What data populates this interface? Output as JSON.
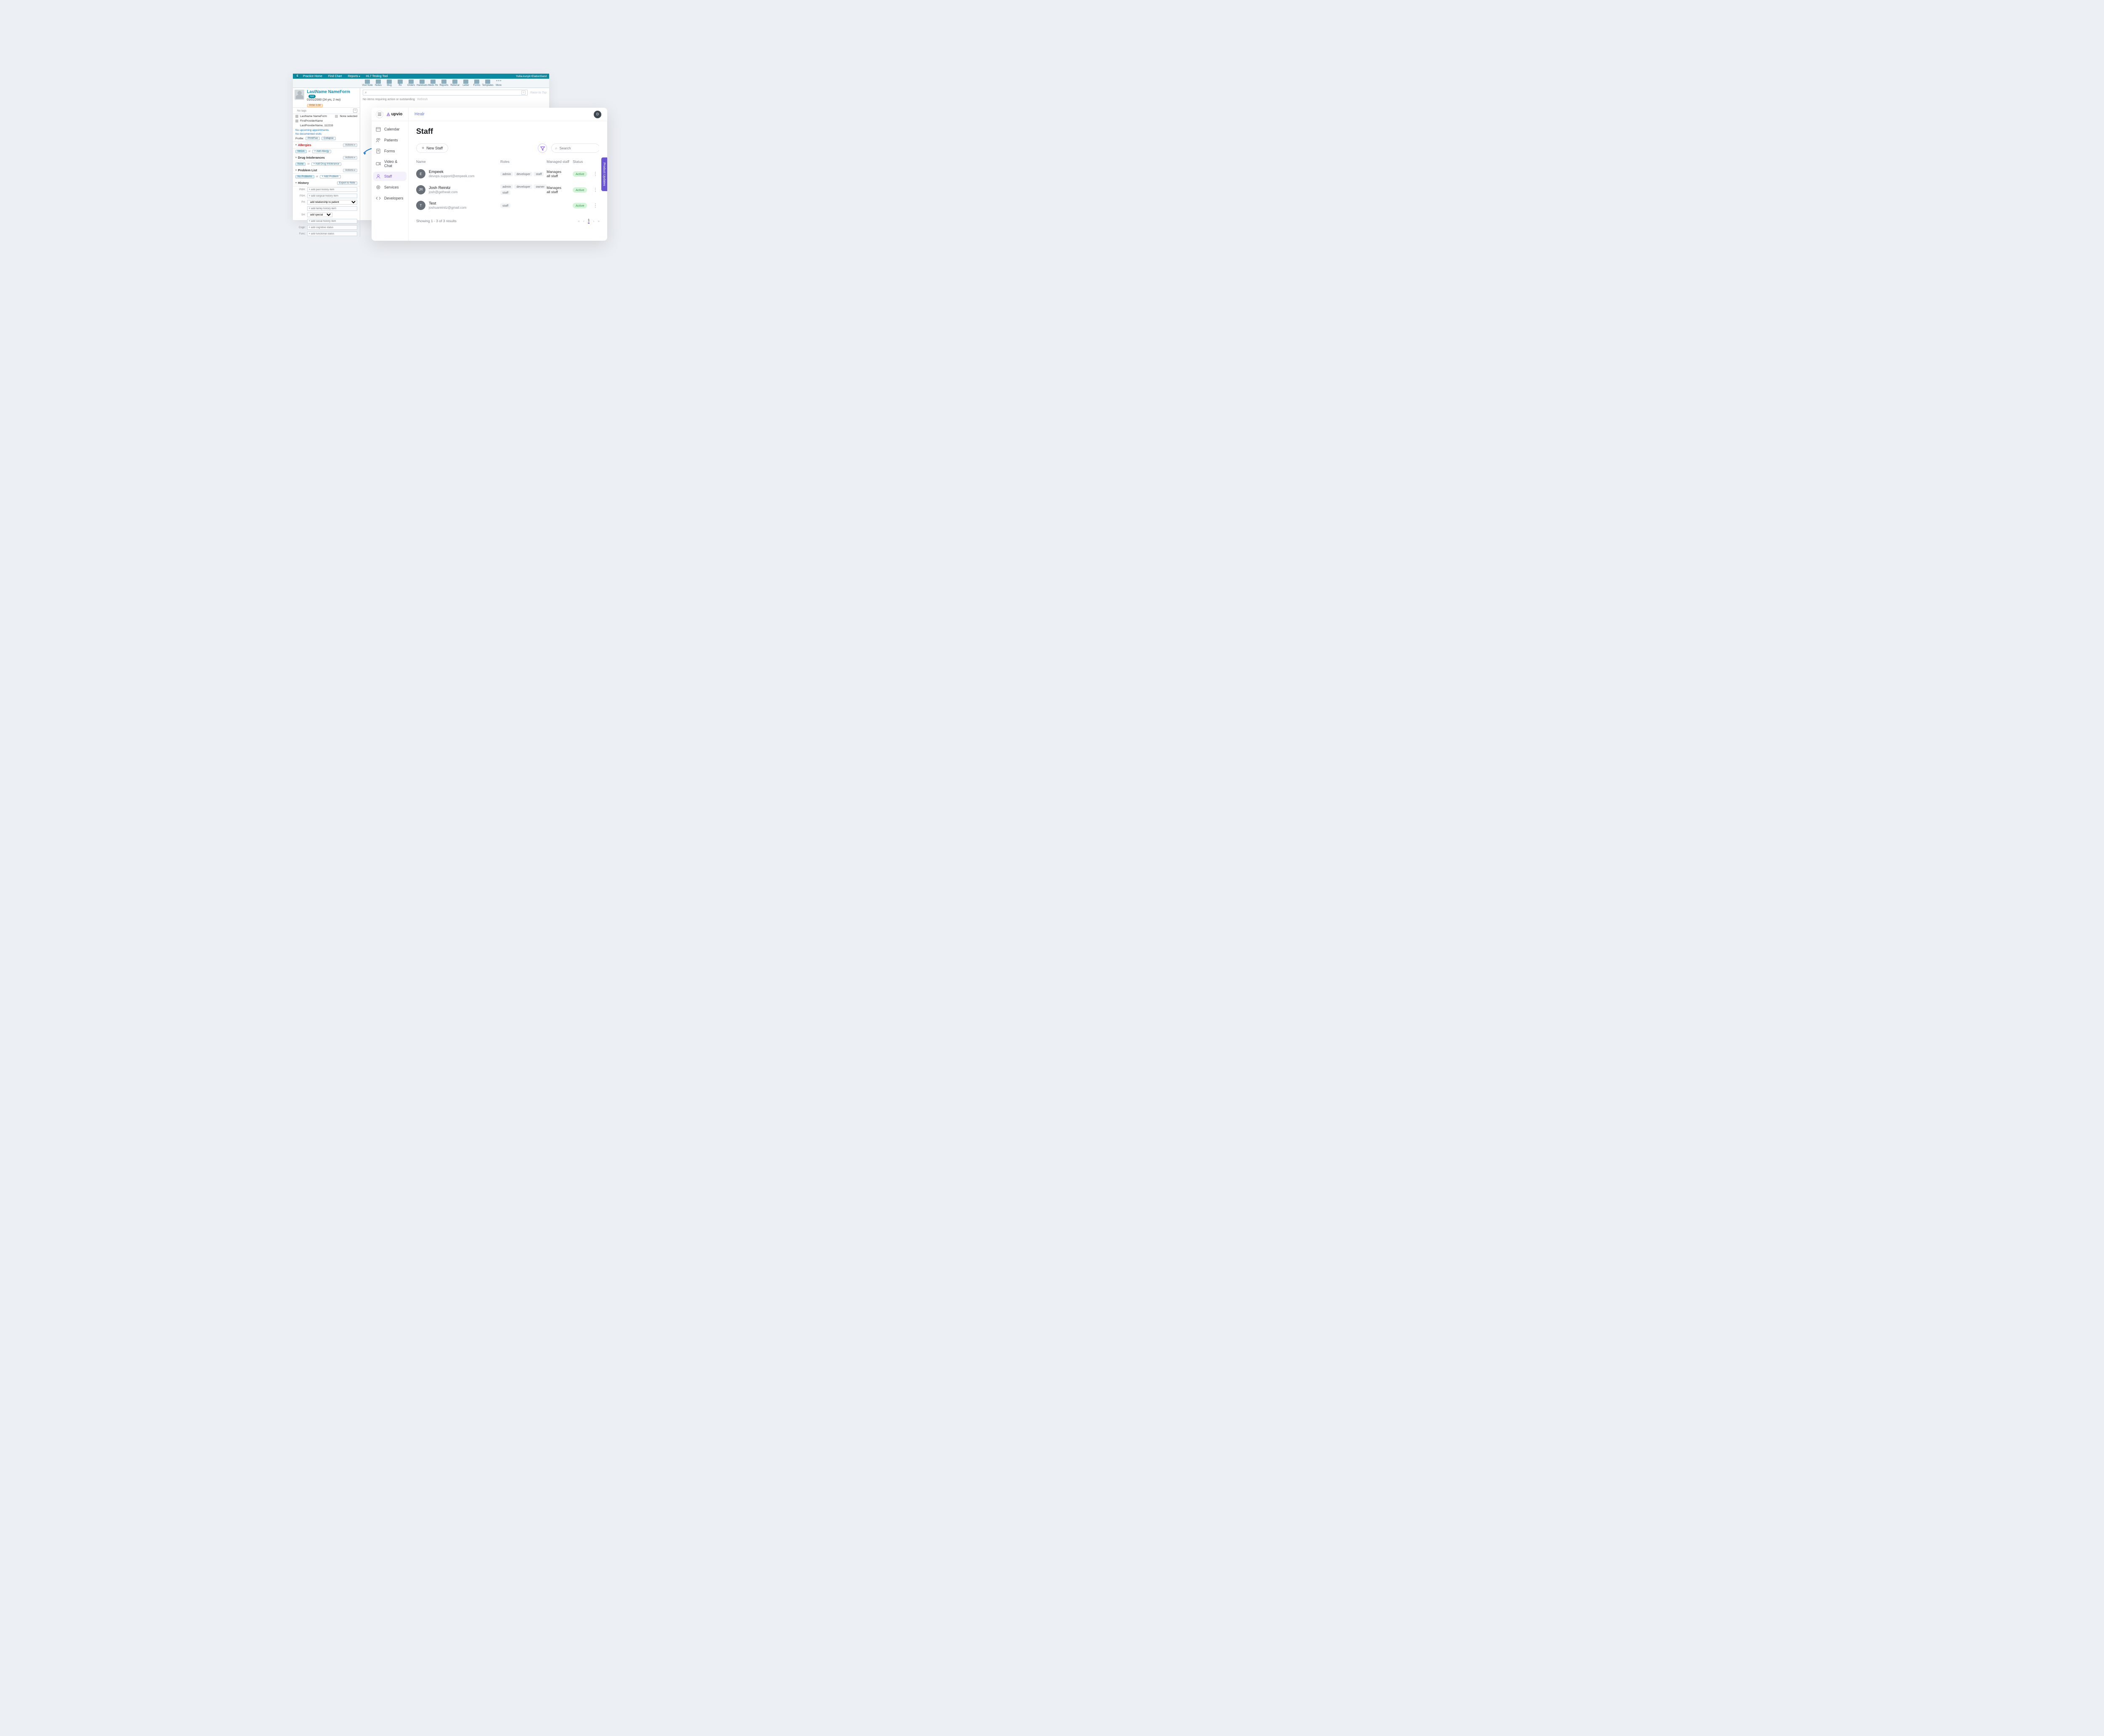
{
  "elation": {
    "topbar": {
      "nav": [
        "Practice Home",
        "Find Chart",
        "Reports",
        "HL7 Testing Tool"
      ],
      "user": "Yuliia.kunyk+ElationSand"
    },
    "toolbar": [
      "Visit Note",
      "Notes",
      "Msg",
      "Rx",
      "Orders",
      "Handouts",
      "Meds Hx",
      "Reports",
      "Referral",
      "Letter",
      "Forms",
      "Templates",
      "More"
    ],
    "patient": {
      "name": "LastName NameForm",
      "badge": "test",
      "dob": "01/01/2000 (24 yrs, 2 mo)",
      "risk": "RISK 0.00",
      "no_tags": "No tags",
      "ids": "LastName NameForm",
      "none_selected": "None selected",
      "provider1": "FirstProviderName",
      "provider2": "LastProviderName, 112233",
      "no_upcoming": "No upcoming appointments",
      "no_visits": "No documented visits",
      "profile_label": "Profile:",
      "printfax": "Print/Fax",
      "collapse": "Collapse"
    },
    "sections": {
      "allergies": {
        "label": "Allergies",
        "actions": "Actions",
        "nkda": "NKDA",
        "or": "or",
        "add": "+ Add Allergy"
      },
      "drug": {
        "label": "Drug Intolerances",
        "actions": "Actions",
        "none": "None",
        "or": "or",
        "add": "+ Add Drug Intolerance"
      },
      "problems": {
        "label": "Problem List",
        "actions": "Actions",
        "none": "No Problems",
        "or": "or",
        "add": "+ Add Problem"
      },
      "history": {
        "label": "History",
        "export": "Export to Note",
        "pmh": {
          "k": "PMH:",
          "ph": "+ add past history item"
        },
        "psh": {
          "k": "PSH:",
          "ph": "+ add surgical history item"
        },
        "fh": {
          "k": "FH:",
          "sel": "add relationship to patient",
          "ph": "+ add family history item"
        },
        "sh": {
          "k": "SH:",
          "sel": "add special",
          "ph": "+ add social history item"
        },
        "cogn": {
          "k": "Cogn:",
          "ph": "+ add cognitive status"
        },
        "func": {
          "k": "Func:",
          "ph": "+ add functional status"
        }
      }
    },
    "main": {
      "raise_top": "Raise to Top",
      "status": "No items requiring action or outstanding",
      "refresh": "Refresh"
    }
  },
  "upvio": {
    "logo": "upvio",
    "org": "Healr",
    "avatar": "D",
    "title": "Staff",
    "sidebar": [
      "Calendar",
      "Patients",
      "Forms",
      "Video & Chat",
      "Staff",
      "Services",
      "Developers"
    ],
    "new_staff": "New Staff",
    "search_ph": "Search",
    "columns": {
      "name": "Name",
      "roles": "Roles",
      "managed": "Managed staff",
      "status": "Status"
    },
    "rows": [
      {
        "ava": "E",
        "name": "Empeek",
        "email": "devops.support@empeek.com",
        "roles": [
          "admin",
          "developer",
          "staff"
        ],
        "managed": "Manages all staff",
        "status": "Active"
      },
      {
        "ava": "JR",
        "name": "Josh Reinitz",
        "email": "josh@gethealr.com",
        "roles": [
          "admin",
          "developer",
          "owner",
          "staff"
        ],
        "managed": "Manages all staff",
        "status": "Active"
      },
      {
        "ava": "T",
        "name": "Test",
        "email": "joshuareinitz@gmail.com",
        "roles": [
          "staff"
        ],
        "managed": "",
        "status": "Active"
      }
    ],
    "results": "Showing 1 - 3 of 3 results",
    "page": "1",
    "updates": "Product Updates"
  }
}
